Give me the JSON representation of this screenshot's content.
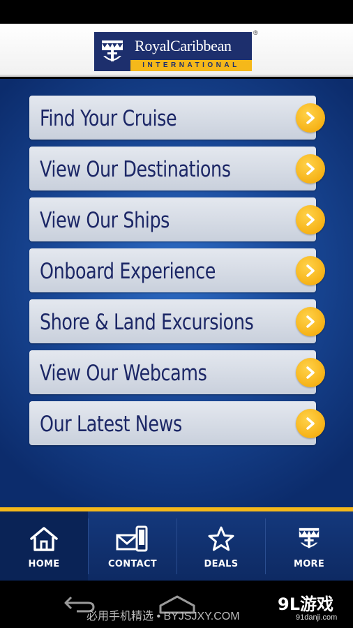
{
  "header": {
    "logo_name": "RoyalCaribbean",
    "logo_sub": "INTERNATIONAL",
    "logo_mark": "®"
  },
  "menu": [
    {
      "label": "Find Your Cruise"
    },
    {
      "label": "View Our Destinations"
    },
    {
      "label": "View Our Ships"
    },
    {
      "label": "Onboard Experience"
    },
    {
      "label": "Shore & Land Excursions"
    },
    {
      "label": "View Our Webcams"
    },
    {
      "label": "Our Latest News"
    }
  ],
  "tabs": [
    {
      "label": "HOME",
      "icon": "home-icon"
    },
    {
      "label": "CONTACT",
      "icon": "contact-icon"
    },
    {
      "label": "DEALS",
      "icon": "star-icon"
    },
    {
      "label": "MORE",
      "icon": "crown-anchor-icon"
    }
  ],
  "active_tab": "HOME",
  "watermark": {
    "text": "必用手机精选 • BYJSJXY.COM",
    "brand": "9L游戏",
    "brand_sub": "91danji.com"
  },
  "colors": {
    "brand_navy": "#1d2f6d",
    "accent_gold": "#f5b81a",
    "menu_text": "#1c2766"
  }
}
